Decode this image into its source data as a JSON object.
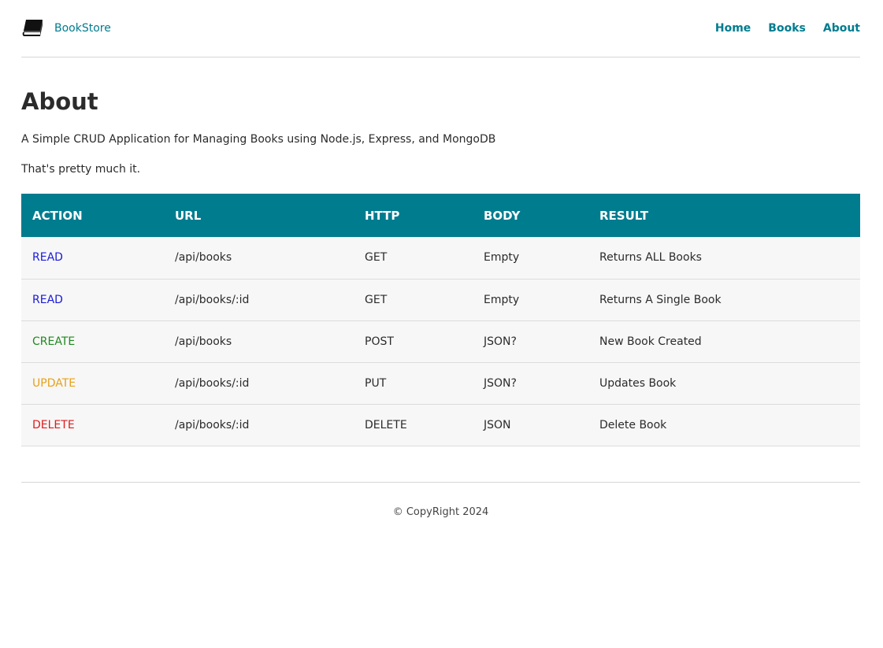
{
  "header": {
    "brand_name": "BookStore",
    "brand_icon": "book-icon",
    "nav": [
      {
        "label": "Home"
      },
      {
        "label": "Books"
      },
      {
        "label": "About"
      }
    ]
  },
  "main": {
    "title": "About",
    "description": "A Simple CRUD Application for Managing Books using Node.js, Express, and MongoDB",
    "note": "That's pretty much it.",
    "table": {
      "header_color": "#007c8f",
      "columns": [
        "ACTION",
        "URL",
        "HTTP",
        "BODY",
        "RESULT"
      ],
      "rows": [
        {
          "action": "READ",
          "action_color": "#1a1adb",
          "url": "/api/books",
          "http": "GET",
          "body": "Empty",
          "result": "Returns ALL Books"
        },
        {
          "action": "READ",
          "action_color": "#1a1adb",
          "url": "/api/books/:id",
          "http": "GET",
          "body": "Empty",
          "result": "Returns A Single Book"
        },
        {
          "action": "CREATE",
          "action_color": "#1f8a1f",
          "url": "/api/books",
          "http": "POST",
          "body": "JSON?",
          "result": "New Book Created"
        },
        {
          "action": "UPDATE",
          "action_color": "#e6a11a",
          "url": "/api/books/:id",
          "http": "PUT",
          "body": "JSON?",
          "result": "Updates Book"
        },
        {
          "action": "DELETE",
          "action_color": "#e01a1a",
          "url": "/api/books/:id",
          "http": "DELETE",
          "body": "JSON",
          "result": "Delete Book"
        }
      ]
    }
  },
  "footer": {
    "text": "© CopyRight 2024"
  }
}
